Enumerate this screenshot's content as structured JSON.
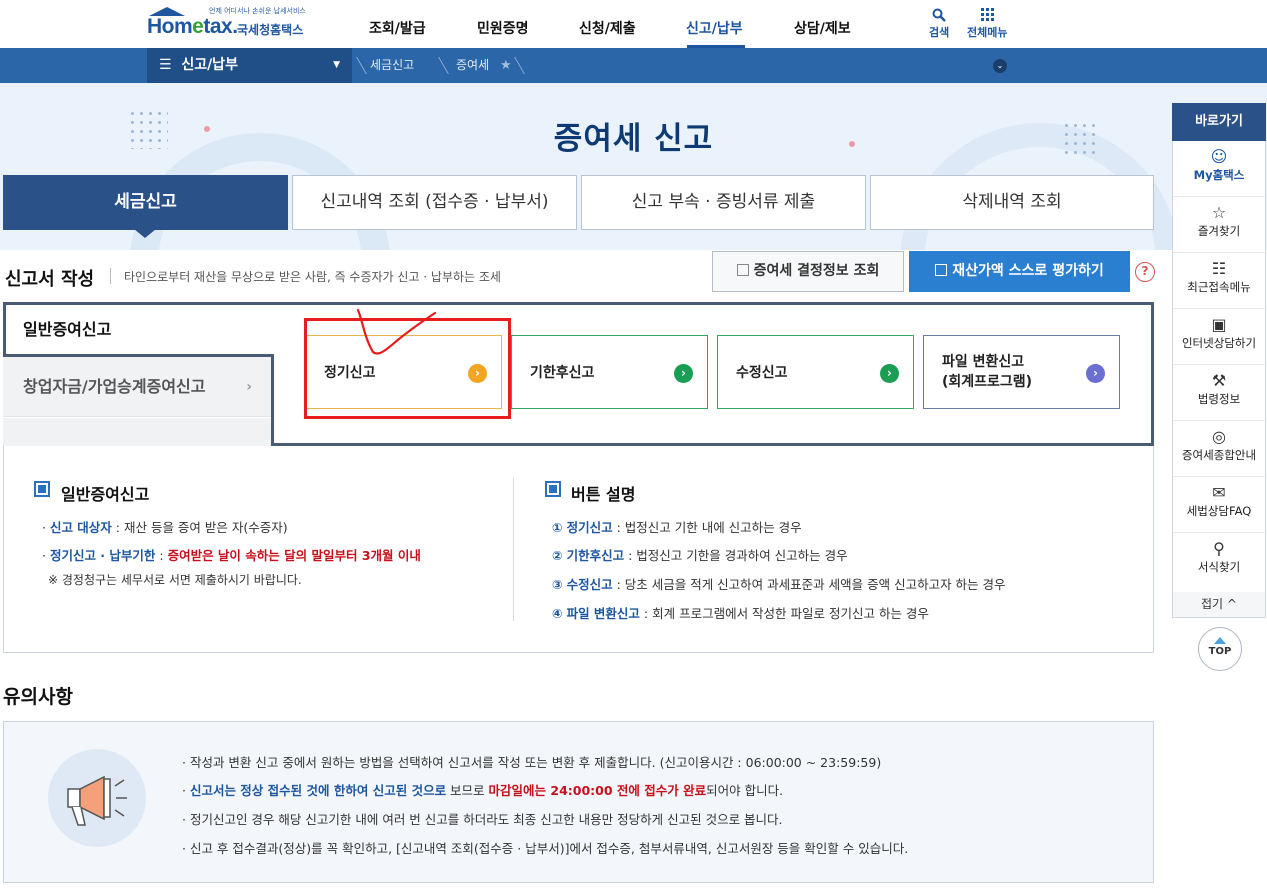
{
  "header": {
    "logo_tagline": "언제 어디서나 손쉬운 납세서비스",
    "logo_brand_pre": "Hom",
    "logo_brand_e": "e",
    "logo_brand_post": "tax.",
    "logo_korean": "국세청홈택스",
    "nav": [
      "조회/발급",
      "민원증명",
      "신청/제출",
      "신고/납부",
      "상담/제보"
    ],
    "active_nav": "신고/납부",
    "search_label": "검색",
    "all_menu_label": "전체메뉴"
  },
  "breadcrumb": {
    "menu_label": "신고/납부",
    "items": [
      "세금신고",
      "증여세"
    ]
  },
  "page_title": "증여세 신고",
  "tabs": [
    "세금신고",
    "신고내역 조회 (접수증 · 납부서)",
    "신고 부속 · 증빙서류 제출",
    "삭제내역 조회"
  ],
  "section": {
    "title": "신고서 작성",
    "description": "타인으로부터 재산을 무상으로 받은 사람, 즉 수증자가 신고 · 납부하는 조세",
    "lookup_button": "증여세 결정정보 조회",
    "eval_button": "재산가액 스스로 평가하기",
    "help_icon": "?"
  },
  "side_tabs": [
    "일반증여신고",
    "창업자금/가업승계증여신고"
  ],
  "side_tab_chevron": "›",
  "cards": [
    {
      "label": "정기신고",
      "color": "#f2a423"
    },
    {
      "label": "기한후신고",
      "color": "#1a9e54"
    },
    {
      "label": "수정신고",
      "color": "#1a9e54"
    },
    {
      "label_line1": "파일 변환신고",
      "label_line2": "(회계프로그램)",
      "color": "#6b6fd0"
    }
  ],
  "card_arrow": "›",
  "info_left": {
    "title": "일반증여신고",
    "line1_label": "신고 대상자",
    "line1_text": " : 재산 등을 증여 받은 자(수증자)",
    "line2_label": "정기신고 · 납부기한",
    "line2_sep": " : ",
    "line2_text": "증여받은 날이 속하는 달의 말일부터 3개월 이내",
    "note": "※ 경정청구는 세무서로 서면 제출하시기 바랍니다."
  },
  "info_right": {
    "title": "버튼 설명",
    "items": [
      {
        "num": "①",
        "label": "정기신고",
        "text": " : 법정신고 기한 내에 신고하는 경우"
      },
      {
        "num": "②",
        "label": "기한후신고",
        "text": " : 법정신고 기한을 경과하여 신고하는 경우"
      },
      {
        "num": "③",
        "label": "수정신고",
        "text": " : 당초 세금을 적게 신고하여 과세표준과 세액을 증액 신고하고자 하는 경우"
      },
      {
        "num": "④",
        "label": "파일 변환신고",
        "text": " : 회계 프로그램에서 작성한 파일로 정기신고 하는 경우"
      }
    ]
  },
  "notes": {
    "title": "유의사항",
    "line1": "작성과 변환 신고 중에서 원하는 방법을 선택하여 신고서를 작성 또는 변환 후 제출합니다. (신고이용시간 : 06:00:00 ~ 23:59:59)",
    "line2_blue": "신고서는 정상 접수된 것에 한하여 신고된 것으로",
    "line2_mid": " 보므로 ",
    "line2_red": "마감일에는 24:00:00 전에 접수가 완료",
    "line2_end": "되어야 합니다.",
    "line3": "정기신고인 경우 해당 신고기한 내에 여러 번 신고를 하더라도 최종 신고한 내용만 정당하게 신고된 것으로 봅니다.",
    "line4": "신고 후 접수결과(정상)를 꼭 확인하고, [신고내역 조회(접수증 · 납부서)]에서 접수증, 첨부서류내역, 신고서원장 등을 확인할 수 있습니다."
  },
  "quick_menu": {
    "title": "바로가기",
    "items": [
      {
        "label": "My홈택스",
        "icon": "person-icon"
      },
      {
        "label": "즐겨찾기",
        "icon": "star-icon"
      },
      {
        "label": "최근접속메뉴",
        "icon": "recent-icon"
      },
      {
        "label": "인터넷상담하기",
        "icon": "laptop-icon"
      },
      {
        "label": "법령정보",
        "icon": "gavel-icon"
      },
      {
        "label": "증여세종합안내",
        "icon": "coins-icon"
      },
      {
        "label": "세법상담FAQ",
        "icon": "chat-icon"
      },
      {
        "label": "서식찾기",
        "icon": "search-icon"
      }
    ],
    "fold_label": "접기",
    "top_label": "TOP"
  },
  "colors": {
    "primary": "#1e56a0",
    "tab_active": "#2a5288",
    "eval_button": "#2b7fd0",
    "annotation": "#e81c1c"
  }
}
